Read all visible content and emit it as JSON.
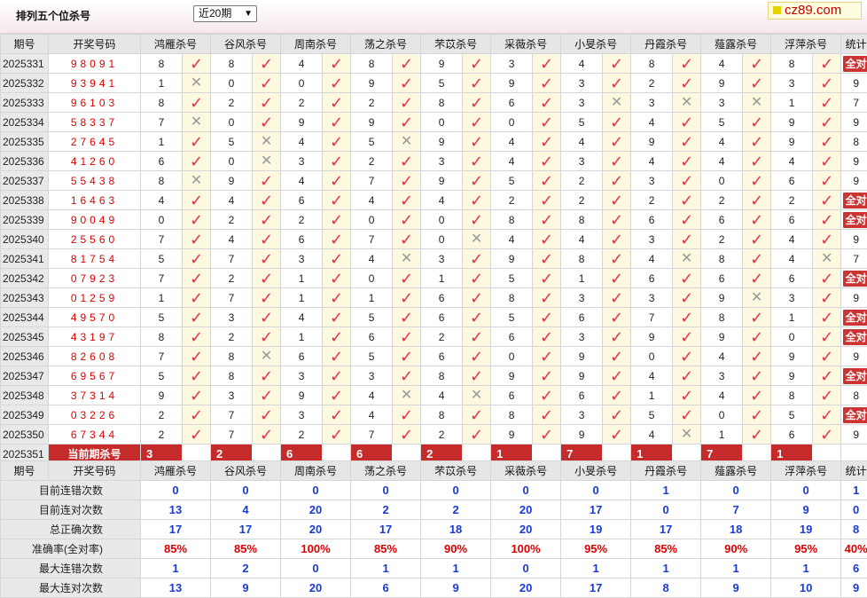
{
  "page": {
    "title": "排列五个位杀号",
    "period_select": "近20期",
    "brand": "cz89.com"
  },
  "table": {
    "col_period": "期号",
    "col_number": "开奖号码",
    "col_total": "统计",
    "experts": [
      "鸿雁杀号",
      "谷风杀号",
      "周南杀号",
      "荡之杀号",
      "芣苡杀号",
      "采薇杀号",
      "小旻杀号",
      "丹霞杀号",
      "薤露杀号",
      "浮萍杀号"
    ],
    "rows": [
      {
        "p": "2025331",
        "n": "98091",
        "k": [
          "8",
          "8",
          "4",
          "8",
          "9",
          "3",
          "4",
          "8",
          "4",
          "8"
        ],
        "r": [
          1,
          1,
          1,
          1,
          1,
          1,
          1,
          1,
          1,
          1
        ],
        "t": "全对"
      },
      {
        "p": "2025332",
        "n": "93941",
        "k": [
          "1",
          "0",
          "0",
          "9",
          "5",
          "9",
          "3",
          "2",
          "9",
          "3"
        ],
        "r": [
          0,
          1,
          1,
          1,
          1,
          1,
          1,
          1,
          1,
          1
        ],
        "t": "9"
      },
      {
        "p": "2025333",
        "n": "96103",
        "k": [
          "8",
          "2",
          "2",
          "2",
          "8",
          "6",
          "3",
          "3",
          "3",
          "1"
        ],
        "r": [
          1,
          1,
          1,
          1,
          1,
          1,
          0,
          0,
          0,
          1
        ],
        "t": "7"
      },
      {
        "p": "2025334",
        "n": "58337",
        "k": [
          "7",
          "0",
          "9",
          "9",
          "0",
          "0",
          "5",
          "4",
          "5",
          "9"
        ],
        "r": [
          0,
          1,
          1,
          1,
          1,
          1,
          1,
          1,
          1,
          1
        ],
        "t": "9"
      },
      {
        "p": "2025335",
        "n": "27645",
        "k": [
          "1",
          "5",
          "4",
          "5",
          "9",
          "4",
          "4",
          "9",
          "4",
          "9"
        ],
        "r": [
          1,
          0,
          1,
          0,
          1,
          1,
          1,
          1,
          1,
          1
        ],
        "t": "8"
      },
      {
        "p": "2025336",
        "n": "41260",
        "k": [
          "6",
          "0",
          "3",
          "2",
          "3",
          "4",
          "3",
          "4",
          "4",
          "4"
        ],
        "r": [
          1,
          0,
          1,
          1,
          1,
          1,
          1,
          1,
          1,
          1
        ],
        "t": "9"
      },
      {
        "p": "2025337",
        "n": "55438",
        "k": [
          "8",
          "9",
          "4",
          "7",
          "9",
          "5",
          "2",
          "3",
          "0",
          "6"
        ],
        "r": [
          0,
          1,
          1,
          1,
          1,
          1,
          1,
          1,
          1,
          1
        ],
        "t": "9"
      },
      {
        "p": "2025338",
        "n": "16463",
        "k": [
          "4",
          "4",
          "6",
          "4",
          "4",
          "2",
          "2",
          "2",
          "2",
          "2"
        ],
        "r": [
          1,
          1,
          1,
          1,
          1,
          1,
          1,
          1,
          1,
          1
        ],
        "t": "全对"
      },
      {
        "p": "2025339",
        "n": "90049",
        "k": [
          "0",
          "2",
          "2",
          "0",
          "0",
          "8",
          "8",
          "6",
          "6",
          "6"
        ],
        "r": [
          1,
          1,
          1,
          1,
          1,
          1,
          1,
          1,
          1,
          1
        ],
        "t": "全对"
      },
      {
        "p": "2025340",
        "n": "25560",
        "k": [
          "7",
          "4",
          "6",
          "7",
          "0",
          "4",
          "4",
          "3",
          "2",
          "4"
        ],
        "r": [
          1,
          1,
          1,
          1,
          0,
          1,
          1,
          1,
          1,
          1
        ],
        "t": "9"
      },
      {
        "p": "2025341",
        "n": "81754",
        "k": [
          "5",
          "7",
          "3",
          "4",
          "3",
          "9",
          "8",
          "4",
          "8",
          "4"
        ],
        "r": [
          1,
          1,
          1,
          0,
          1,
          1,
          1,
          0,
          1,
          0
        ],
        "t": "7"
      },
      {
        "p": "2025342",
        "n": "07923",
        "k": [
          "7",
          "2",
          "1",
          "0",
          "1",
          "5",
          "1",
          "6",
          "6",
          "6"
        ],
        "r": [
          1,
          1,
          1,
          1,
          1,
          1,
          1,
          1,
          1,
          1
        ],
        "t": "全对"
      },
      {
        "p": "2025343",
        "n": "01259",
        "k": [
          "1",
          "7",
          "1",
          "1",
          "6",
          "8",
          "3",
          "3",
          "9",
          "3"
        ],
        "r": [
          1,
          1,
          1,
          1,
          1,
          1,
          1,
          1,
          0,
          1
        ],
        "t": "9"
      },
      {
        "p": "2025344",
        "n": "49570",
        "k": [
          "5",
          "3",
          "4",
          "5",
          "6",
          "5",
          "6",
          "7",
          "8",
          "1"
        ],
        "r": [
          1,
          1,
          1,
          1,
          1,
          1,
          1,
          1,
          1,
          1
        ],
        "t": "全对"
      },
      {
        "p": "2025345",
        "n": "43197",
        "k": [
          "8",
          "2",
          "1",
          "6",
          "2",
          "6",
          "3",
          "9",
          "9",
          "0"
        ],
        "r": [
          1,
          1,
          1,
          1,
          1,
          1,
          1,
          1,
          1,
          1
        ],
        "t": "全对"
      },
      {
        "p": "2025346",
        "n": "82608",
        "k": [
          "7",
          "8",
          "6",
          "5",
          "6",
          "0",
          "9",
          "0",
          "4",
          "9"
        ],
        "r": [
          1,
          0,
          1,
          1,
          1,
          1,
          1,
          1,
          1,
          1
        ],
        "t": "9"
      },
      {
        "p": "2025347",
        "n": "69567",
        "k": [
          "5",
          "8",
          "3",
          "3",
          "8",
          "9",
          "9",
          "4",
          "3",
          "9"
        ],
        "r": [
          1,
          1,
          1,
          1,
          1,
          1,
          1,
          1,
          1,
          1
        ],
        "t": "全对"
      },
      {
        "p": "2025348",
        "n": "37314",
        "k": [
          "9",
          "3",
          "9",
          "4",
          "4",
          "6",
          "6",
          "1",
          "4",
          "8"
        ],
        "r": [
          1,
          1,
          1,
          0,
          0,
          1,
          1,
          1,
          1,
          1
        ],
        "t": "8"
      },
      {
        "p": "2025349",
        "n": "03226",
        "k": [
          "2",
          "7",
          "3",
          "4",
          "8",
          "8",
          "3",
          "5",
          "0",
          "5"
        ],
        "r": [
          1,
          1,
          1,
          1,
          1,
          1,
          1,
          1,
          1,
          1
        ],
        "t": "全对"
      },
      {
        "p": "2025350",
        "n": "67344",
        "k": [
          "2",
          "7",
          "2",
          "7",
          "2",
          "9",
          "9",
          "4",
          "1",
          "6"
        ],
        "r": [
          1,
          1,
          1,
          1,
          1,
          1,
          1,
          0,
          1,
          1
        ],
        "t": "9"
      }
    ],
    "current": {
      "p": "2025351",
      "label": "当前期杀号",
      "k": [
        "3",
        "2",
        "6",
        "6",
        "2",
        "1",
        "7",
        "1",
        "7",
        "1"
      ]
    }
  },
  "stats": {
    "rows": [
      {
        "label": "目前连错次数",
        "v": [
          "0",
          "0",
          "0",
          "0",
          "0",
          "0",
          "0",
          "1",
          "0",
          "0"
        ],
        "t": "1",
        "red": false
      },
      {
        "label": "目前连对次数",
        "v": [
          "13",
          "4",
          "20",
          "2",
          "2",
          "20",
          "17",
          "0",
          "7",
          "9"
        ],
        "t": "0",
        "red": false
      },
      {
        "label": "总正确次数",
        "v": [
          "17",
          "17",
          "20",
          "17",
          "18",
          "20",
          "19",
          "17",
          "18",
          "19"
        ],
        "t": "8",
        "red": false
      },
      {
        "label": "准确率(全对率)",
        "v": [
          "85%",
          "85%",
          "100%",
          "85%",
          "90%",
          "100%",
          "95%",
          "85%",
          "90%",
          "95%"
        ],
        "t": "40%",
        "red": true
      },
      {
        "label": "最大连错次数",
        "v": [
          "1",
          "2",
          "0",
          "1",
          "1",
          "0",
          "1",
          "1",
          "1",
          "1"
        ],
        "t": "6",
        "red": false
      },
      {
        "label": "最大连对次数",
        "v": [
          "13",
          "9",
          "20",
          "6",
          "9",
          "20",
          "17",
          "8",
          "9",
          "10"
        ],
        "t": "9",
        "red": false
      }
    ]
  },
  "icons": {
    "hit": "check-icon",
    "miss": "cross-icon"
  },
  "colors": {
    "accent_red": "#c52b2b",
    "hit_red": "#e23240",
    "stat_blue": "#1a3bd1"
  }
}
